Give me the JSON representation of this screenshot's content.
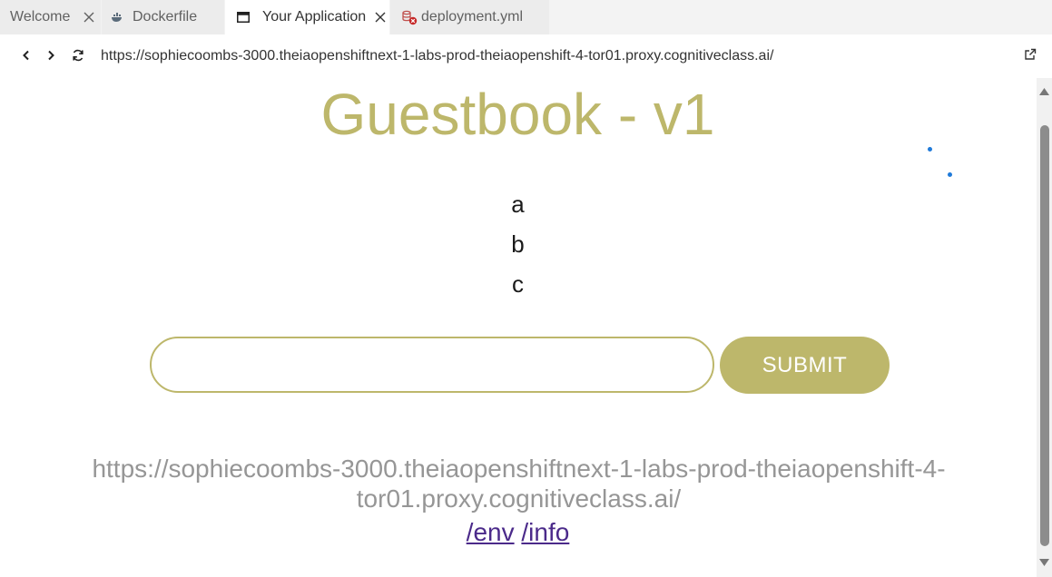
{
  "tabs": [
    {
      "label": "Welcome",
      "closable": true,
      "active": false
    },
    {
      "label": "Dockerfile",
      "icon": "docker-icon",
      "closable": false,
      "active": false
    },
    {
      "label": "Your Application",
      "icon": "browser-window-icon",
      "closable": true,
      "active": true
    },
    {
      "label": "deployment.yml",
      "icon": "yaml-error-icon",
      "closable": false,
      "active": false
    }
  ],
  "browser": {
    "url": "https://sophiecoombs-3000.theiaopenshiftnext-1-labs-prod-theiaopenshift-4-tor01.proxy.cognitiveclass.ai/"
  },
  "page": {
    "title": "Guestbook - v1",
    "entries": [
      "a",
      "b",
      "c"
    ],
    "input_value": "",
    "submit_label": "SUBMIT",
    "host_url_line1": "https://sophiecoombs-3000.theiaopenshiftnext-1-labs-prod-theiaopenshift-4-",
    "host_url_line2": "tor01.proxy.cognitiveclass.ai/",
    "links": [
      {
        "label": "/env"
      },
      {
        "label": "/info"
      }
    ]
  },
  "colors": {
    "accent": "#bdb76b",
    "link": "#4b2a8a",
    "muted_text": "#969696",
    "tab_bar_bg": "#f3f3f3"
  }
}
